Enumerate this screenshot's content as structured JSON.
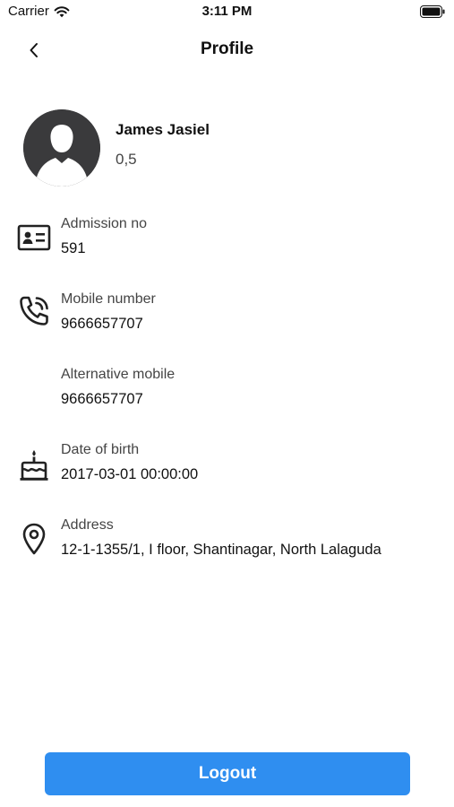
{
  "status_bar": {
    "carrier": "Carrier",
    "time": "3:11 PM"
  },
  "nav": {
    "title": "Profile",
    "back_icon": "chevron-left-icon"
  },
  "profile": {
    "name": "James Jasiel",
    "subtitle": "0,5",
    "avatar_icon": "user-silhouette-icon"
  },
  "details": [
    {
      "icon": "id-card-icon",
      "label": "Admission no",
      "value": "591"
    },
    {
      "icon": "phone-call-icon",
      "label": "Mobile number",
      "value": "9666657707"
    },
    {
      "icon": "",
      "label": "Alternative mobile",
      "value": "9666657707"
    },
    {
      "icon": "birthday-cake-icon",
      "label": "Date of birth",
      "value": "2017-03-01 00:00:00"
    },
    {
      "icon": "location-pin-icon",
      "label": "Address",
      "value": "12-1-1355/1, I floor, Shantinagar, North Lalaguda"
    }
  ],
  "logout": {
    "label": "Logout"
  },
  "colors": {
    "accent": "#2f8ef0",
    "avatar_bg": "#3a3a3c"
  }
}
